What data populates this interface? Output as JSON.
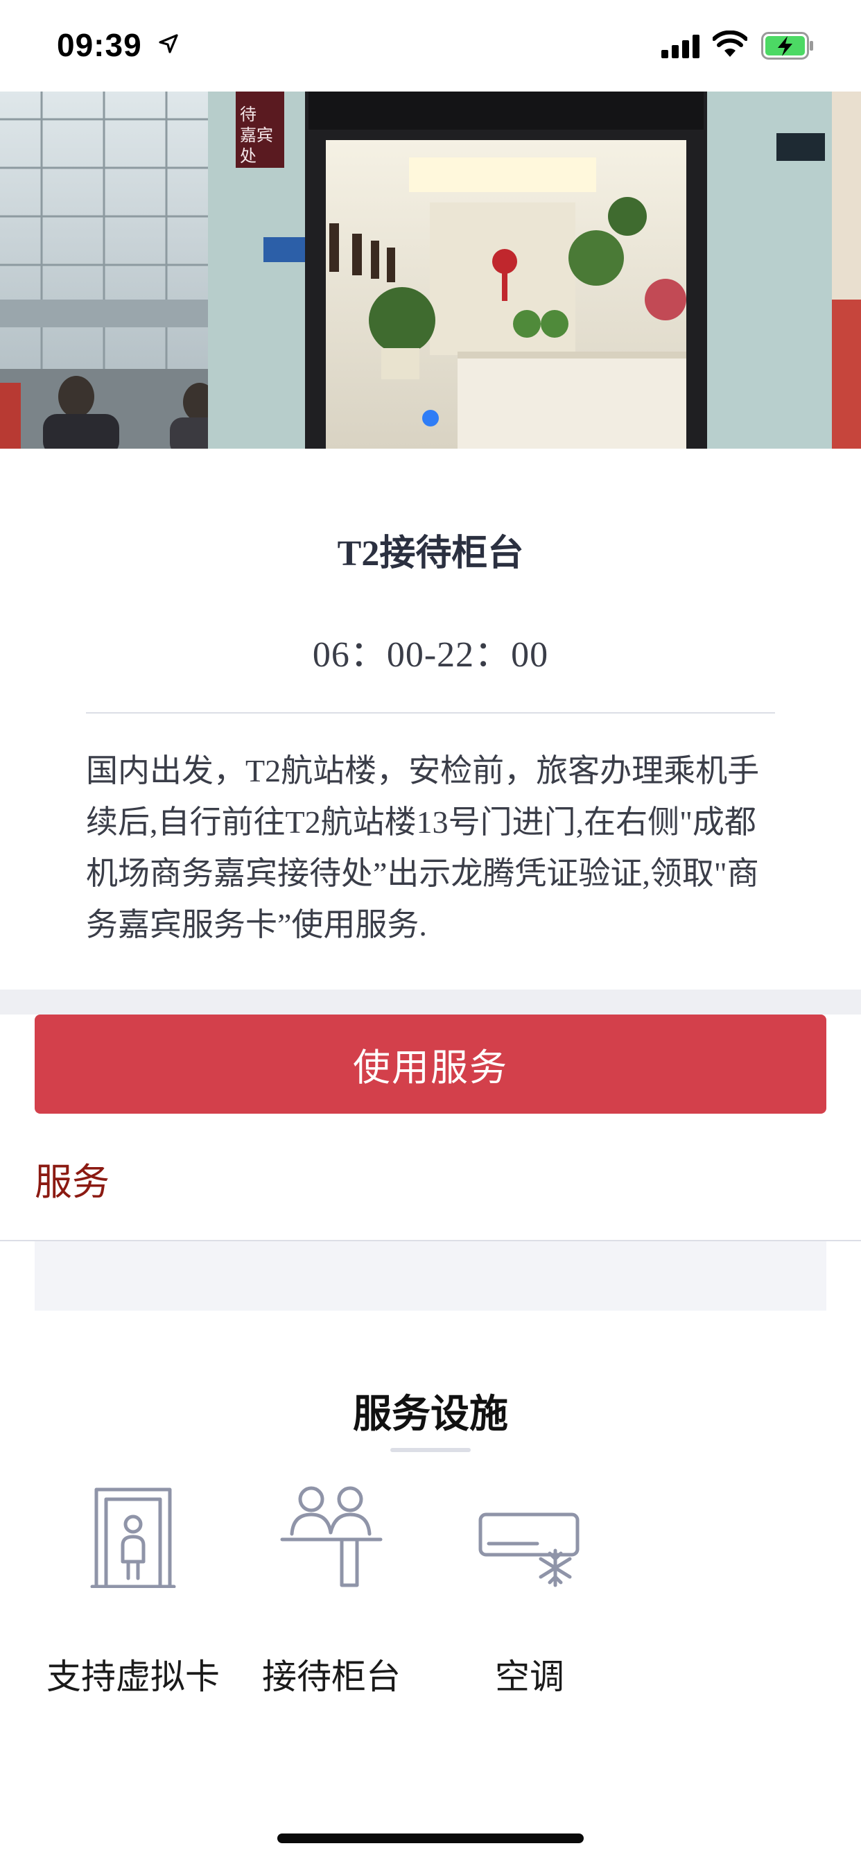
{
  "status_bar": {
    "time": "09:39",
    "icons": [
      "location-arrow-icon",
      "cellular-signal-icon",
      "wifi-icon",
      "battery-charging-icon"
    ]
  },
  "hero": {
    "sign_text": "待 嘉宾 处",
    "carousel_active_index": 0,
    "carousel_dot_color": "#2f7df6"
  },
  "place": {
    "title": "T2接待柜台",
    "hours": "06：00-22：00",
    "description": "国内出发，T2航站楼，安检前，旅客办理乘机手续后,自行前往T2航站楼13号门进门,在右侧\"成都机场商务嘉宾接待处”出示龙腾凭证验证,领取\"商务嘉宾服务卡”使用服务."
  },
  "actions": {
    "use_service_label": "使用服务",
    "button_color": "#d3404b"
  },
  "tabs": {
    "service_label": "服务",
    "active_color": "#8b1a12"
  },
  "facilities": {
    "heading": "服务设施",
    "items": [
      {
        "label": "支持虚拟卡",
        "icon": "virtual-card-gate-icon"
      },
      {
        "label": "接待柜台",
        "icon": "reception-counter-icon"
      },
      {
        "label": "空调",
        "icon": "air-conditioner-icon"
      }
    ]
  }
}
